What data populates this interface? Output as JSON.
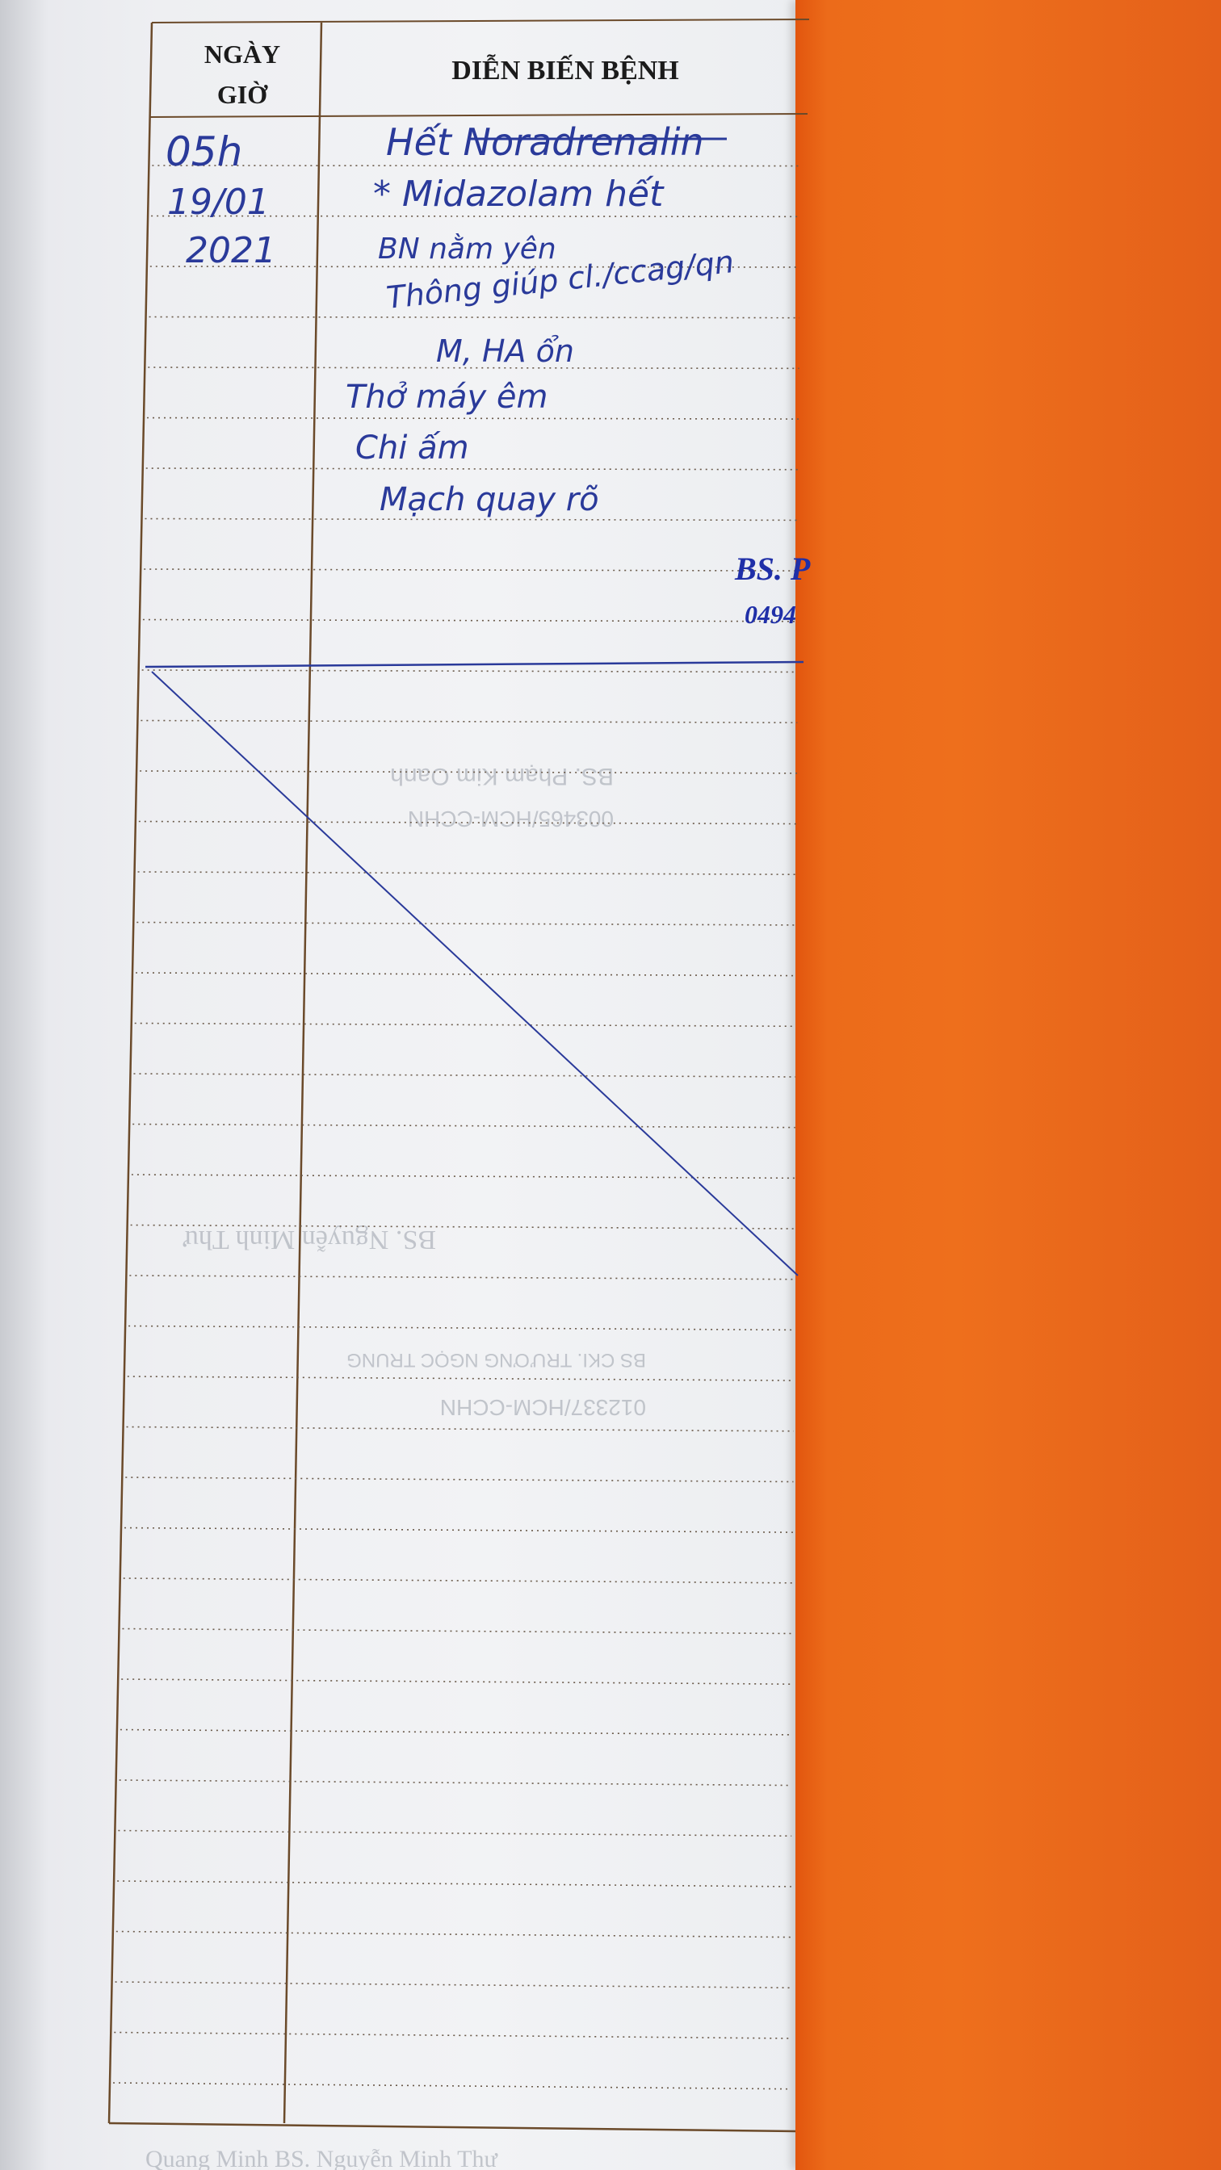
{
  "table": {
    "col_date_header_line1": "NGÀY",
    "col_date_header_line2": "GIỜ",
    "col_progress_header": "DIỄN BIẾN BỆNH"
  },
  "entry": {
    "time": "05h",
    "date": "19/01",
    "year": "2021",
    "notes": [
      "Hết Noradrenalin",
      "* Midazolam hết",
      "BN nằm yên",
      "Thông giúp cl./ccag/qn",
      "M, HA ổn",
      "Thở máy êm",
      "Chi ấm",
      "Mạch quay rõ"
    ],
    "strikethrough_word": "Noradrenalin"
  },
  "stamp": {
    "doctor_prefix": "BS. P",
    "license_prefix": "0494"
  },
  "bleed_through": {
    "name_1": "BS. Phạm Kim Oanh",
    "code_1": "003465/HCM-CCHN",
    "name_2": "BS. Nguyễn Minh Thư",
    "name_3": "BS CKI. TRƯƠNG NGỌC TRUNG",
    "code_3": "012337/HCM-CCHN",
    "bottom_text": "Quang Minh   BS. Nguyễn Minh Thư"
  },
  "colors": {
    "ink": "#2a3a9a",
    "stamp_ink": "#1f2fa8",
    "rule_brown": "#6b4a2a",
    "folder_orange": "#ee6f1c"
  }
}
